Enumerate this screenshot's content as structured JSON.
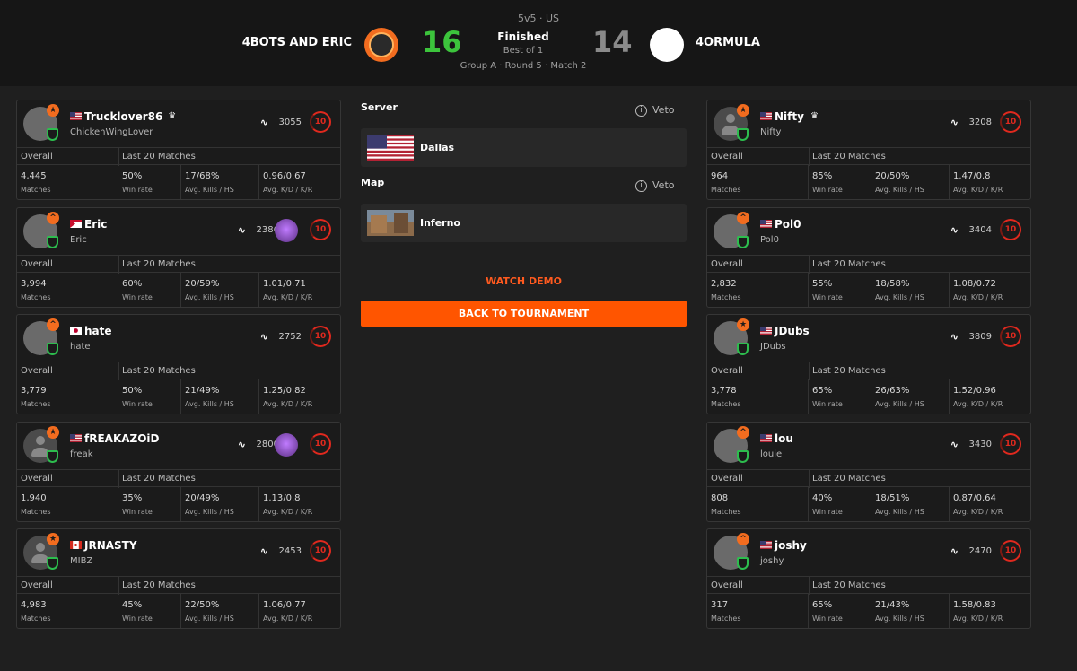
{
  "match": {
    "format": "5v5 · US",
    "status": "Finished",
    "best_of": "Best of 1",
    "stage": "Group A · Round 5 · Match 2",
    "team_left": {
      "name": "4BOTS AND ERIC",
      "score": "16"
    },
    "team_right": {
      "name": "4ORMULA",
      "score": "14"
    }
  },
  "colors": {
    "win": "#3cc43c",
    "lose": "#8a8a8a",
    "accent": "#ff5500",
    "level": "#e0291e"
  },
  "stat_headers": {
    "overall": "Overall",
    "last20": "Last 20 Matches"
  },
  "stat_labels": {
    "matches": "Matches",
    "winrate": "Win rate",
    "kills_hs": "Avg. Kills / HS",
    "kd_kr": "Avg. K/D / K/R"
  },
  "center": {
    "server_label": "Server",
    "map_label": "Map",
    "veto_label": "Veto",
    "server": "Dallas",
    "map": "Inferno",
    "watch_demo": "WATCH DEMO",
    "back": "BACK TO TOURNAMENT"
  },
  "left_players": [
    {
      "name": "Trucklover86",
      "nickname": "ChickenWingLover",
      "elo": "3055",
      "level": "10",
      "matches": "4,445",
      "winrate": "50%",
      "kills_hs": "17/68%",
      "kd_kr": "0.96/0.67",
      "flag": "us",
      "crown": true
    },
    {
      "name": "Eric",
      "nickname": "Eric",
      "elo": "2386",
      "level": "10",
      "matches": "3,994",
      "winrate": "60%",
      "kills_hs": "20/59%",
      "kd_kr": "1.01/0.71",
      "flag": "other"
    },
    {
      "name": "hate",
      "nickname": "hate",
      "elo": "2752",
      "level": "10",
      "matches": "3,779",
      "winrate": "50%",
      "kills_hs": "21/49%",
      "kd_kr": "1.25/0.82",
      "flag": "jp"
    },
    {
      "name": "fREAKAZOiD",
      "nickname": "freak",
      "elo": "2800",
      "level": "10",
      "matches": "1,940",
      "winrate": "35%",
      "kills_hs": "20/49%",
      "kd_kr": "1.13/0.8",
      "flag": "us"
    },
    {
      "name": "JRNASTY",
      "nickname": "MIBZ",
      "elo": "2453",
      "level": "10",
      "matches": "4,983",
      "winrate": "45%",
      "kills_hs": "22/50%",
      "kd_kr": "1.06/0.77",
      "flag": "ca"
    }
  ],
  "right_players": [
    {
      "name": "Nifty",
      "nickname": "Nifty",
      "elo": "3208",
      "level": "10",
      "matches": "964",
      "winrate": "85%",
      "kills_hs": "20/50%",
      "kd_kr": "1.47/0.8",
      "flag": "us",
      "crown": true
    },
    {
      "name": "Pol0",
      "nickname": "Pol0",
      "elo": "3404",
      "level": "10",
      "matches": "2,832",
      "winrate": "55%",
      "kills_hs": "18/58%",
      "kd_kr": "1.08/0.72",
      "flag": "us"
    },
    {
      "name": "JDubs",
      "nickname": "JDubs",
      "elo": "3809",
      "level": "10",
      "matches": "3,778",
      "winrate": "65%",
      "kills_hs": "26/63%",
      "kd_kr": "1.52/0.96",
      "flag": "us"
    },
    {
      "name": "lou",
      "nickname": "louie",
      "elo": "3430",
      "level": "10",
      "matches": "808",
      "winrate": "40%",
      "kills_hs": "18/51%",
      "kd_kr": "0.87/0.64",
      "flag": "us"
    },
    {
      "name": "joshy",
      "nickname": "joshy",
      "elo": "2470",
      "level": "10",
      "matches": "317",
      "winrate": "65%",
      "kills_hs": "21/43%",
      "kd_kr": "1.58/0.83",
      "flag": "us"
    }
  ]
}
